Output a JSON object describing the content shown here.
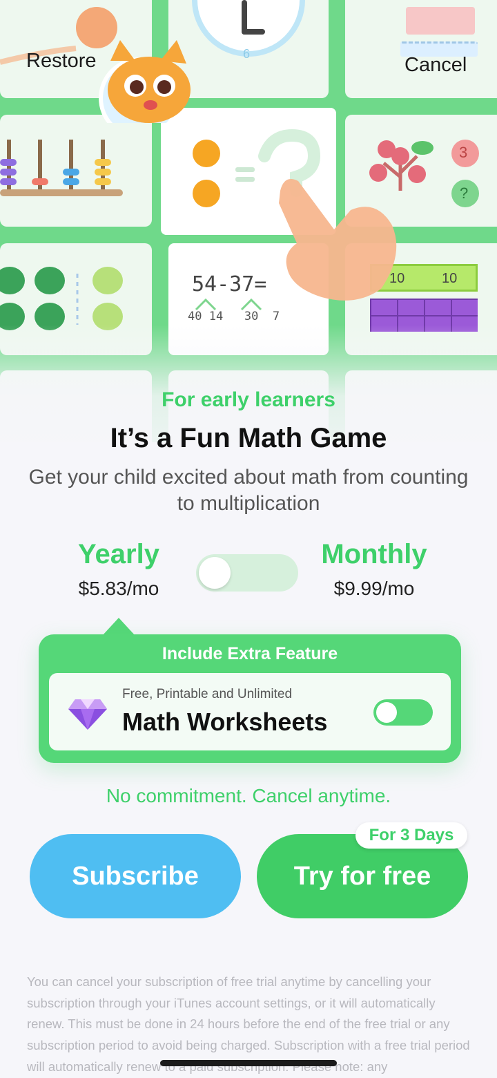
{
  "header": {
    "restore_label": "Restore",
    "cancel_label": "Cancel"
  },
  "hero": {
    "clock_number": "6",
    "equation": "54-37=",
    "decomposition": "40 14   30  7",
    "bar_numbers": [
      "10",
      "10"
    ],
    "circle_number": "3",
    "circle_question": "?"
  },
  "intro": {
    "tagline": "For early learners",
    "headline": "It’s a Fun Math Game",
    "subhead": "Get your child excited about math from counting to multiplication"
  },
  "plans": {
    "yearly": {
      "name": "Yearly",
      "price": "$5.83/mo"
    },
    "monthly": {
      "name": "Monthly",
      "price": "$9.99/mo"
    }
  },
  "extra_feature": {
    "title": "Include Extra Feature",
    "small_text": "Free, Printable and Unlimited",
    "name": "Math Worksheets"
  },
  "no_commitment": "No commitment. Cancel anytime.",
  "actions": {
    "subscribe_label": "Subscribe",
    "trial_label": "Try for free",
    "trial_badge": "For 3 Days"
  },
  "legal_text": "You can cancel your subscription of free trial anytime by cancelling your subscription through your iTunes account settings, or it will automatically renew. This must be done in 24 hours before the end of the free trial or any subscription period to avoid being charged. Subscription with a free trial period will automatically renew to a paid subscription. Please note: any",
  "colors": {
    "accent_green": "#3ed06a",
    "subscribe_blue": "#4fbef2",
    "trial_green": "#40cd66"
  }
}
